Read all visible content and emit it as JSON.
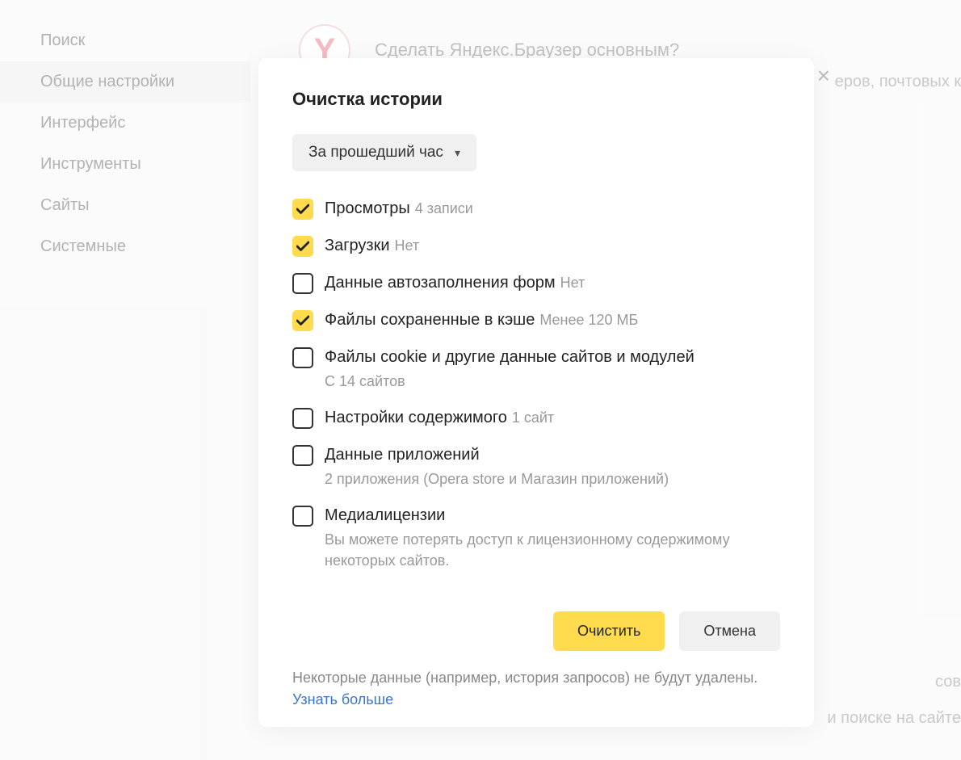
{
  "sidebar": {
    "items": [
      {
        "label": "Поиск"
      },
      {
        "label": "Общие настройки"
      },
      {
        "label": "Интерфейс"
      },
      {
        "label": "Инструменты"
      },
      {
        "label": "Сайты"
      },
      {
        "label": "Системные"
      }
    ]
  },
  "bg": {
    "logo_letter": "Y",
    "header_text": "Сделать Яндекс.Браузер основным?",
    "right_text1": "еров, почтовых к",
    "right_text2": "сов",
    "right_text3": "и поиске на сайте"
  },
  "modal": {
    "title": "Очистка истории",
    "time_range": "За прошедший час",
    "options": [
      {
        "label": "Просмотры",
        "hint_inline": "4 записи",
        "checked": true
      },
      {
        "label": "Загрузки",
        "hint_inline": "Нет",
        "checked": true
      },
      {
        "label": "Данные автозаполнения форм",
        "hint_inline": "Нет",
        "checked": false
      },
      {
        "label": "Файлы сохраненные в кэше",
        "hint_inline": "Менее 120 МБ",
        "checked": true
      },
      {
        "label": "Файлы cookie и другие данные сайтов и модулей",
        "hint_below": "С 14 сайтов",
        "checked": false
      },
      {
        "label": "Настройки содержимого",
        "hint_inline": "1 сайт",
        "checked": false
      },
      {
        "label": "Данные приложений",
        "hint_below": "2 приложения (Opera store и Магазин приложений)",
        "checked": false
      },
      {
        "label": "Медиалицензии",
        "hint_below": "Вы можете потерять доступ к лицензионному содержимому некоторых сайтов.",
        "checked": false
      }
    ],
    "primary_btn": "Очистить",
    "secondary_btn": "Отмена",
    "footer_note": "Некоторые данные (например, история запросов) не будут удалены.",
    "footer_link": "Узнать больше"
  }
}
